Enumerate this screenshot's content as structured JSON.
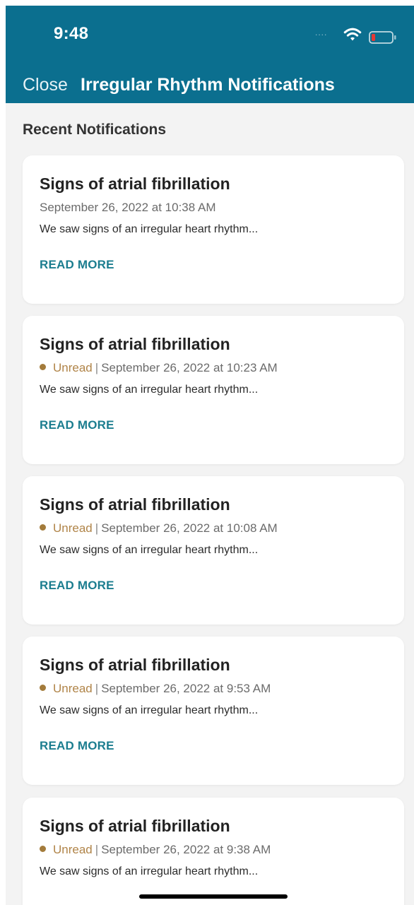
{
  "status_bar": {
    "time": "9:48",
    "signal": "....",
    "wifi_icon": "wifi-icon",
    "battery_icon": "battery-low-icon",
    "battery_color": "#e53935"
  },
  "nav": {
    "close_label": "Close",
    "title": "Irregular Rhythm Notifications",
    "background_color": "#0b6f8f"
  },
  "section": {
    "title": "Recent Notifications"
  },
  "notifications": [
    {
      "title": "Signs of atrial fibrillation",
      "status": "",
      "separator": "",
      "datetime": "September 26, 2022 at 10:38 AM",
      "preview": "We saw signs of an irregular heart rhythm...",
      "action_label": "READ MORE"
    },
    {
      "title": "Signs of atrial fibrillation",
      "status": "Unread",
      "separator": "|",
      "datetime": "September 26, 2022 at 10:23 AM",
      "preview": "We saw signs of an irregular heart rhythm...",
      "action_label": "READ MORE"
    },
    {
      "title": "Signs of atrial fibrillation",
      "status": "Unread",
      "separator": "|",
      "datetime": "September 26, 2022 at 10:08 AM",
      "preview": "We saw signs of an irregular heart rhythm...",
      "action_label": "READ MORE"
    },
    {
      "title": "Signs of atrial fibrillation",
      "status": "Unread",
      "separator": "|",
      "datetime": "September 26, 2022 at 9:53 AM",
      "preview": "We saw signs of an irregular heart rhythm...",
      "action_label": "READ MORE"
    },
    {
      "title": "Signs of atrial fibrillation",
      "status": "Unread",
      "separator": "|",
      "datetime": "September 26, 2022 at 9:38 AM",
      "preview": "We saw signs of an irregular heart rhythm...",
      "action_label": ""
    }
  ],
  "colors": {
    "accent": "#1b7d8f",
    "unread": "#b08448",
    "background": "#f3f3f3"
  }
}
